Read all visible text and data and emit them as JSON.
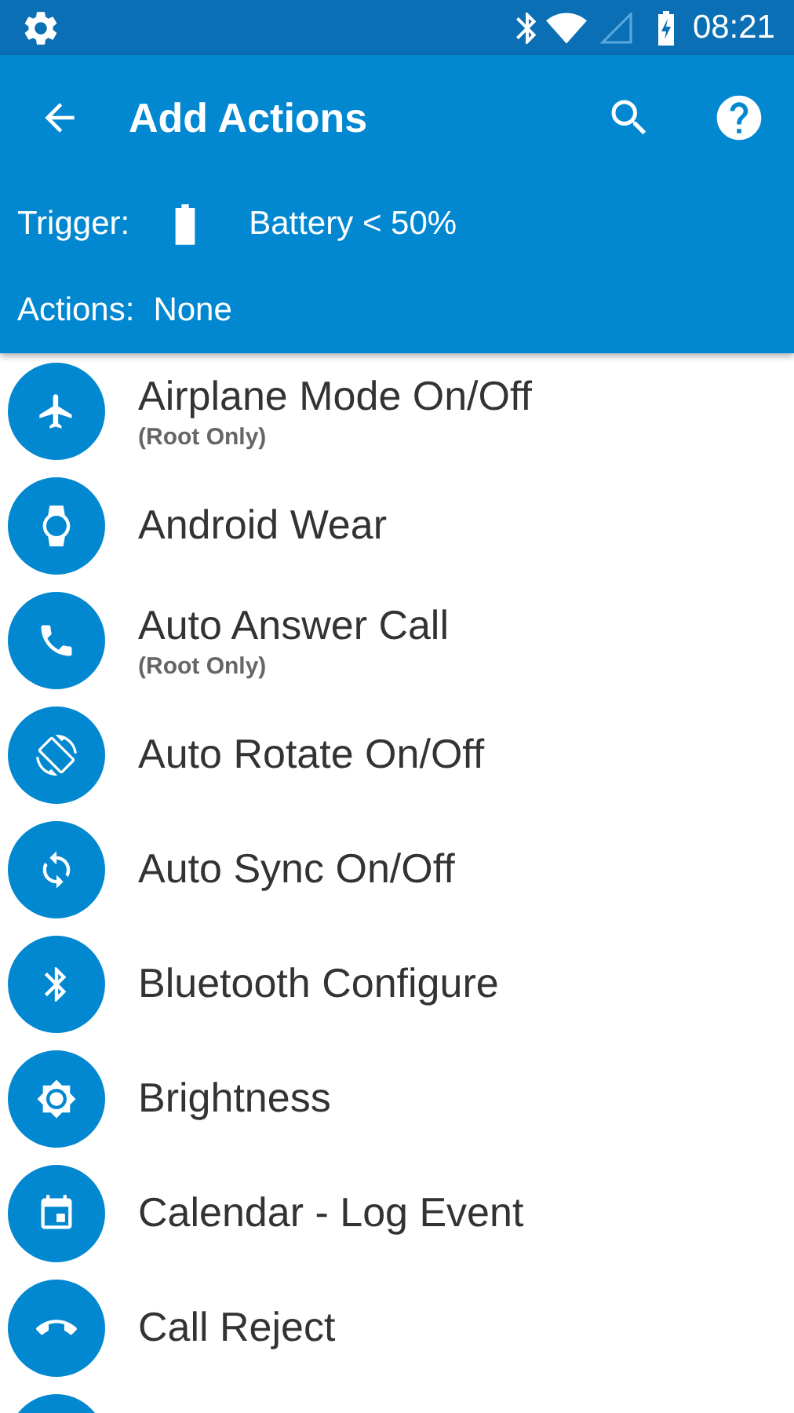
{
  "status_bar": {
    "time": "08:21"
  },
  "toolbar": {
    "title": "Add Actions"
  },
  "trigger": {
    "label": "Trigger:",
    "value": "Battery < 50%"
  },
  "actions": {
    "label": "Actions:",
    "value": "None"
  },
  "items": [
    {
      "title": "Airplane Mode On/Off",
      "note": "(Root Only)"
    },
    {
      "title": "Android Wear"
    },
    {
      "title": "Auto Answer Call",
      "note": "(Root Only)"
    },
    {
      "title": "Auto Rotate On/Off"
    },
    {
      "title": "Auto Sync On/Off"
    },
    {
      "title": "Bluetooth Configure"
    },
    {
      "title": "Brightness"
    },
    {
      "title": "Calendar - Log Event"
    },
    {
      "title": "Call Reject"
    }
  ]
}
